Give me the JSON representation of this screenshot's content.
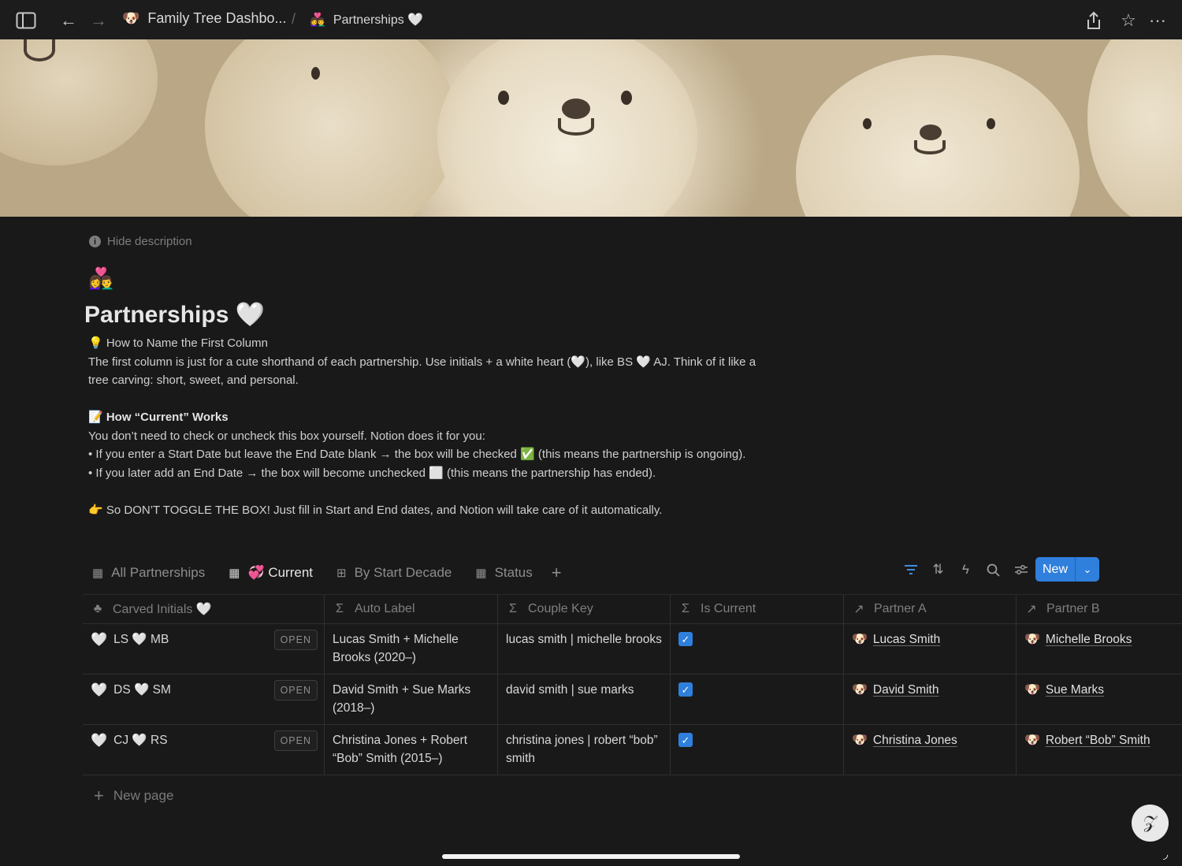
{
  "topbar": {
    "breadcrumb_parent": "Family Tree Dashbo...",
    "breadcrumb_parent_emoji": "🐶",
    "separator": "/",
    "breadcrumb_current": "Partnerships 🤍",
    "breadcrumb_current_emoji": "👩‍❤️‍👨"
  },
  "page": {
    "hide_description": "Hide description",
    "emoji": "👩‍❤️‍👨",
    "title": "Partnerships 🤍",
    "description": [
      {
        "text": "💡 How to Name the First Column",
        "bold": false
      },
      {
        "text": "The first column is just for a cute shorthand of each partnership. Use initials + a white heart (🤍), like BS 🤍 AJ. Think of it like a tree carving: short, sweet, and personal.",
        "bold": false
      },
      {
        "text": "",
        "bold": false
      },
      {
        "text": "📝 How “Current” Works",
        "bold": true
      },
      {
        "text": "You don’t need to check or uncheck this box yourself. Notion does it for you:",
        "bold": false
      },
      {
        "text": "• If you enter a Start Date but leave the End Date blank → the box will be checked ✅ (this means the partnership is ongoing).",
        "bold": false
      },
      {
        "text": "• If you later add an End Date → the box will become unchecked ⬜ (this means the partnership has ended).",
        "bold": false
      },
      {
        "text": "",
        "bold": false
      },
      {
        "text": "👉 So DON’T TOGGLE THE BOX! Just fill in Start and End dates, and Notion will take care of it automatically.",
        "bold": false
      }
    ]
  },
  "tabs": {
    "all": "All Partnerships",
    "current": "💞 Current",
    "decade": "By Start Decade",
    "status": "Status",
    "add": "+"
  },
  "toolbar": {
    "new_label": "New"
  },
  "table": {
    "headers": {
      "initials": "Carved Initials 🤍",
      "auto_label": "Auto Label",
      "couple_key": "Couple Key",
      "is_current": "Is Current",
      "partner_a": "Partner A",
      "partner_b": "Partner B"
    },
    "open_label": "OPEN",
    "rows": [
      {
        "heart": "🤍",
        "initials": "LS 🤍 MB",
        "auto_label": "Lucas Smith + Michelle Brooks (2020–)",
        "couple_key": "lucas smith | michelle brooks",
        "is_current": true,
        "partner_a": "Lucas Smith",
        "partner_b": "Michelle Brooks"
      },
      {
        "heart": "🤍",
        "initials": "DS 🤍 SM",
        "auto_label": "David Smith + Sue Marks (2018–)",
        "couple_key": "david smith | sue marks",
        "is_current": true,
        "partner_a": "David Smith",
        "partner_b": "Sue Marks"
      },
      {
        "heart": "🤍",
        "initials": "CJ 🤍 RS",
        "auto_label": "Christina Jones + Robert “Bob” Smith (2015–)",
        "couple_key": "christina jones | robert “bob” smith",
        "is_current": true,
        "partner_a": "Christina Jones",
        "partner_b": "Robert “Bob” Smith"
      }
    ],
    "new_page": "New page"
  },
  "colors": {
    "accent": "#2f7fdc",
    "background": "#191919"
  }
}
